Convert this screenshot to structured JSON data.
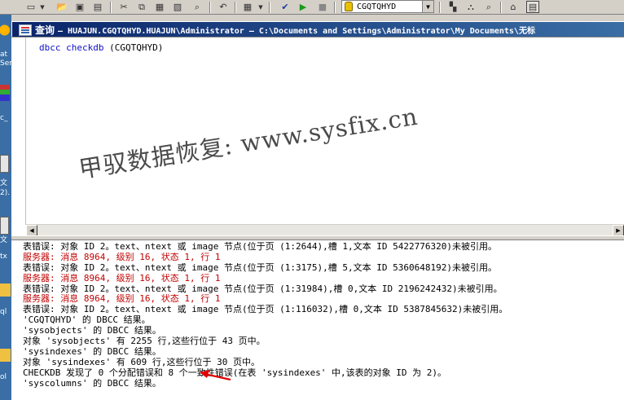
{
  "toolbar": {
    "database": "CGQTQHYD"
  },
  "desktop_labels": [
    "at",
    "Ser",
    "c_",
    "文",
    "2).",
    "文",
    "tx",
    "ql",
    "ol"
  ],
  "window": {
    "title_label": "查询",
    "title_path": "— HUAJUN.CGQTQHYD.HUAJUN\\Administrator — C:\\Documents and Settings\\Administrator\\My Documents\\无标"
  },
  "editor": {
    "keyword": "dbcc checkdb",
    "argument": " (CGQTQHYD)"
  },
  "watermark": "甲驭数据恢复: www.sysfix.cn",
  "results": [
    {
      "text": "表错误: 对象 ID 2。text、ntext 或 image 节点(位于页 (1:2644),槽 1,文本 ID 5422776320)未被引用。",
      "type": "normal"
    },
    {
      "text": "服务器: 消息 8964, 级别 16, 状态 1, 行 1",
      "type": "error"
    },
    {
      "text": "表错误: 对象 ID 2。text、ntext 或 image 节点(位于页 (1:3175),槽 5,文本 ID 5360648192)未被引用。",
      "type": "normal"
    },
    {
      "text": "服务器: 消息 8964, 级别 16, 状态 1, 行 1",
      "type": "error"
    },
    {
      "text": "表错误: 对象 ID 2。text、ntext 或 image 节点(位于页 (1:31984),槽 0,文本 ID 2196242432)未被引用。",
      "type": "normal"
    },
    {
      "text": "服务器: 消息 8964, 级别 16, 状态 1, 行 1",
      "type": "error"
    },
    {
      "text": "表错误: 对象 ID 2。text、ntext 或 image 节点(位于页 (1:116032),槽 0,文本 ID 5387845632)未被引用。",
      "type": "normal"
    },
    {
      "text": "'CGQTQHYD' 的 DBCC 结果。",
      "type": "normal"
    },
    {
      "text": "'sysobjects' 的 DBCC 结果。",
      "type": "normal"
    },
    {
      "text": "对象 'sysobjects' 有 2255 行,这些行位于 43 页中。",
      "type": "normal"
    },
    {
      "text": "'sysindexes' 的 DBCC 结果。",
      "type": "normal"
    },
    {
      "text": "对象 'sysindexes' 有 609 行,这些行位于 30 页中。",
      "type": "normal"
    },
    {
      "text": "CHECKDB 发现了 0 个分配错误和 8 个一致性错误(在表 'sysindexes' 中,该表的对象 ID 为 2)。",
      "type": "normal"
    },
    {
      "text": "'syscolumns' 的 DBCC 结果。",
      "type": "normal"
    }
  ]
}
